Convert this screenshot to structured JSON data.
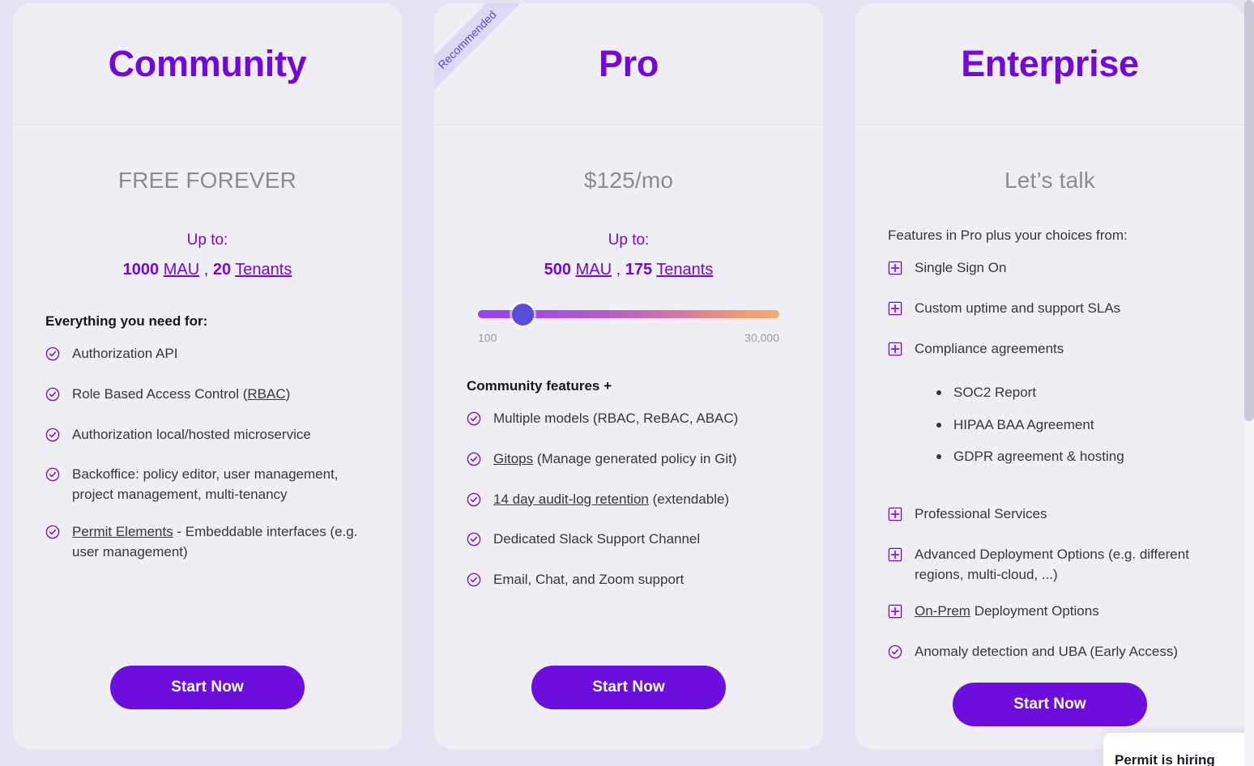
{
  "theme": {
    "accent": "#7309d8",
    "button": "#6c0fde",
    "page_bg": "#e3e3f1",
    "card_bg": "#eeeef4",
    "muted_text": "#8b8b93",
    "ribbon_bg": "#ddd8f4",
    "ribbon_text": "#5b4bdb",
    "slider_thumb": "#5b4bdb"
  },
  "plans": [
    {
      "id": "community",
      "title": "Community",
      "price": "FREE FOREVER",
      "upto_label": "Up to:",
      "limits": {
        "mau_count": "1000",
        "mau_label": "MAU",
        "separator": " , ",
        "tenant_count": "20",
        "tenant_label": "Tenants"
      },
      "list_heading": "Everything you need for:",
      "features": [
        {
          "icon": "check-circle-icon",
          "text": "Authorization API",
          "underline": ""
        },
        {
          "icon": "check-circle-icon",
          "text": "Role Based Access Control (RBAC)",
          "underline": "RBAC"
        },
        {
          "icon": "check-circle-icon",
          "text": "Authorization local/hosted microservice",
          "underline": ""
        },
        {
          "icon": "check-circle-icon",
          "text": "Backoffice: policy editor, user management, project management, multi-tenancy",
          "underline": ""
        },
        {
          "icon": "check-circle-icon",
          "text": "Permit Elements - Embeddable interfaces (e.g. user management)",
          "underline": "Permit Elements"
        }
      ],
      "cta_label": "Start Now"
    },
    {
      "id": "pro",
      "title": "Pro",
      "ribbon": "Recommended",
      "price": "$125/mo",
      "upto_label": "Up to:",
      "limits": {
        "mau_count": "500",
        "mau_label": "MAU",
        "separator": " , ",
        "tenant_count": "175",
        "tenant_label": "Tenants"
      },
      "slider": {
        "min_label": "100",
        "max_label": "30,000",
        "value_percent": 15
      },
      "list_heading": "Community features +",
      "features": [
        {
          "icon": "check-circle-icon",
          "text": "Multiple models (RBAC, ReBAC, ABAC)",
          "underline": ""
        },
        {
          "icon": "check-circle-icon",
          "text": "Gitops (Manage generated policy in Git)",
          "underline": "Gitops"
        },
        {
          "icon": "check-circle-icon",
          "text": "14 day audit-log retention (extendable)",
          "underline": "14 day audit-log retention"
        },
        {
          "icon": "check-circle-icon",
          "text": "Dedicated Slack Support Channel",
          "underline": ""
        },
        {
          "icon": "check-circle-icon",
          "text": "Email, Chat, and Zoom support",
          "underline": ""
        }
      ],
      "cta_label": "Start Now"
    },
    {
      "id": "enterprise",
      "title": "Enterprise",
      "price": "Let’s talk",
      "list_heading": "Features in Pro plus your choices from:",
      "features": [
        {
          "icon": "plus-square-icon",
          "text": "Single Sign On",
          "underline": ""
        },
        {
          "icon": "plus-square-icon",
          "text": "Custom uptime and support SLAs",
          "underline": ""
        },
        {
          "icon": "plus-square-icon",
          "text": "Compliance agreements",
          "underline": "",
          "sub": [
            "SOC2 Report",
            "HIPAA BAA Agreement",
            "GDPR agreement & hosting"
          ]
        },
        {
          "icon": "plus-square-icon",
          "text": "Professional Services",
          "underline": ""
        },
        {
          "icon": "plus-square-icon",
          "text": "Advanced Deployment Options (e.g. different regions, multi-cloud, ...)",
          "underline": ""
        },
        {
          "icon": "plus-square-icon",
          "text": "On-Prem Deployment Options",
          "underline": "On-Prem"
        },
        {
          "icon": "check-circle-icon",
          "text": "Anomaly detection and UBA (Early Access)",
          "underline": ""
        }
      ],
      "cta_label": "Start Now"
    }
  ],
  "widget": {
    "text": "Permit is hiring"
  }
}
